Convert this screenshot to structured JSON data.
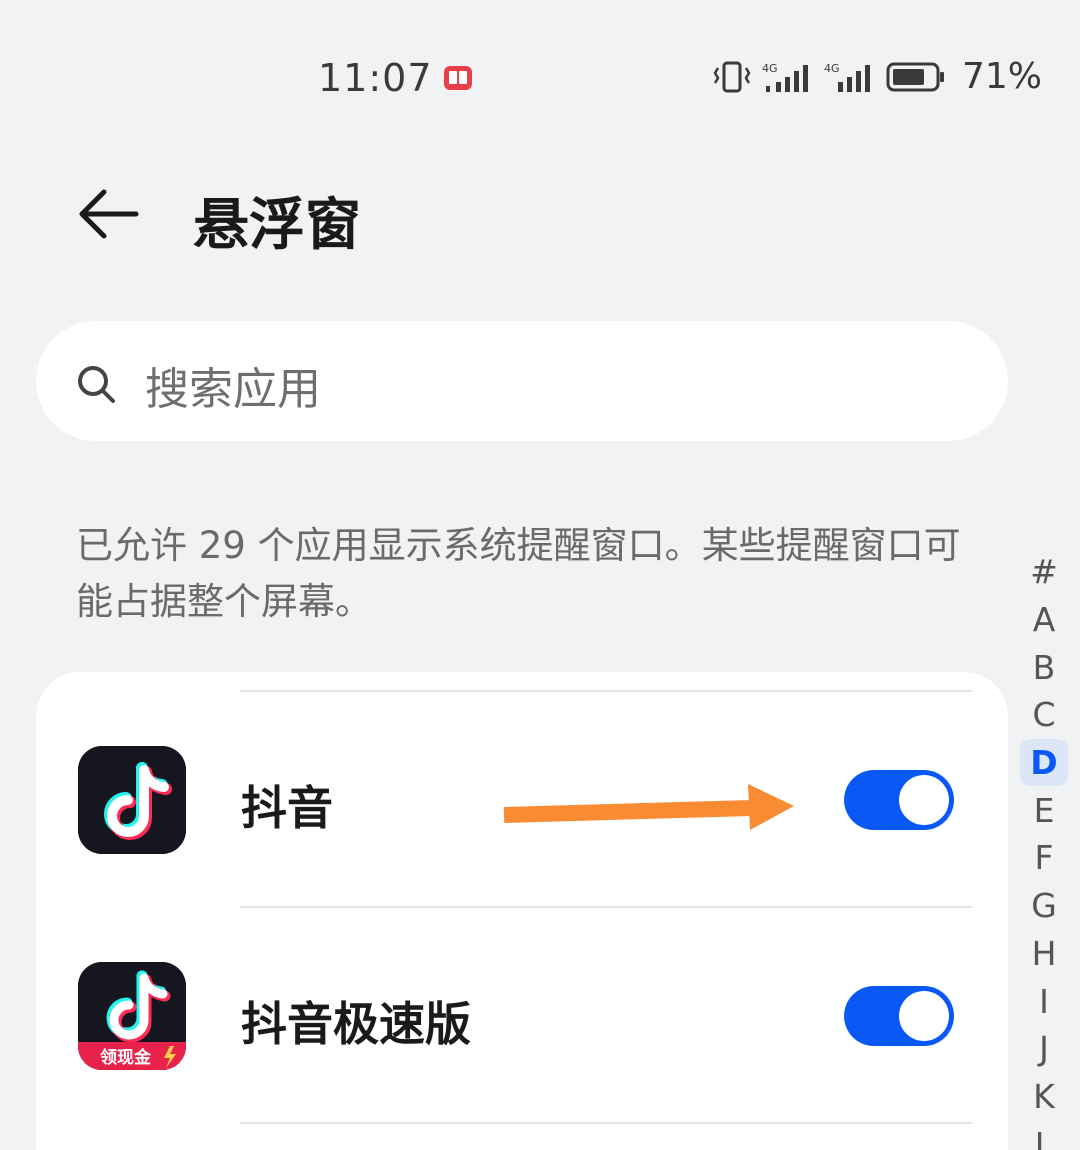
{
  "status_bar": {
    "time": "11:07",
    "network1": "4G",
    "network2": "4G",
    "battery_percent": "71%",
    "icons": [
      "book-notification-icon",
      "vibrate-icon",
      "signal-icon",
      "signal-icon",
      "battery-icon"
    ]
  },
  "header": {
    "back_icon": "arrow-left-icon",
    "title": "悬浮窗"
  },
  "search": {
    "placeholder": "搜索应用",
    "icon": "search-icon"
  },
  "description": "已允许 29 个应用显示系统提醒窗口。某些提醒窗口可能占据整个屏幕。",
  "apps": [
    {
      "name": "抖音",
      "enabled": true,
      "icon": "douyin-app-icon"
    },
    {
      "name": "抖音极速版",
      "enabled": true,
      "icon": "douyin-lite-app-icon",
      "badge": "领现金"
    }
  ],
  "alphabet_index": {
    "letters": [
      "#",
      "A",
      "B",
      "C",
      "D",
      "E",
      "F",
      "G",
      "H",
      "I",
      "J",
      "K",
      "L"
    ],
    "active": "D"
  },
  "colors": {
    "accent": "#0a59f7",
    "background": "#f1f2f4",
    "annotation_arrow": "#f98c33"
  }
}
